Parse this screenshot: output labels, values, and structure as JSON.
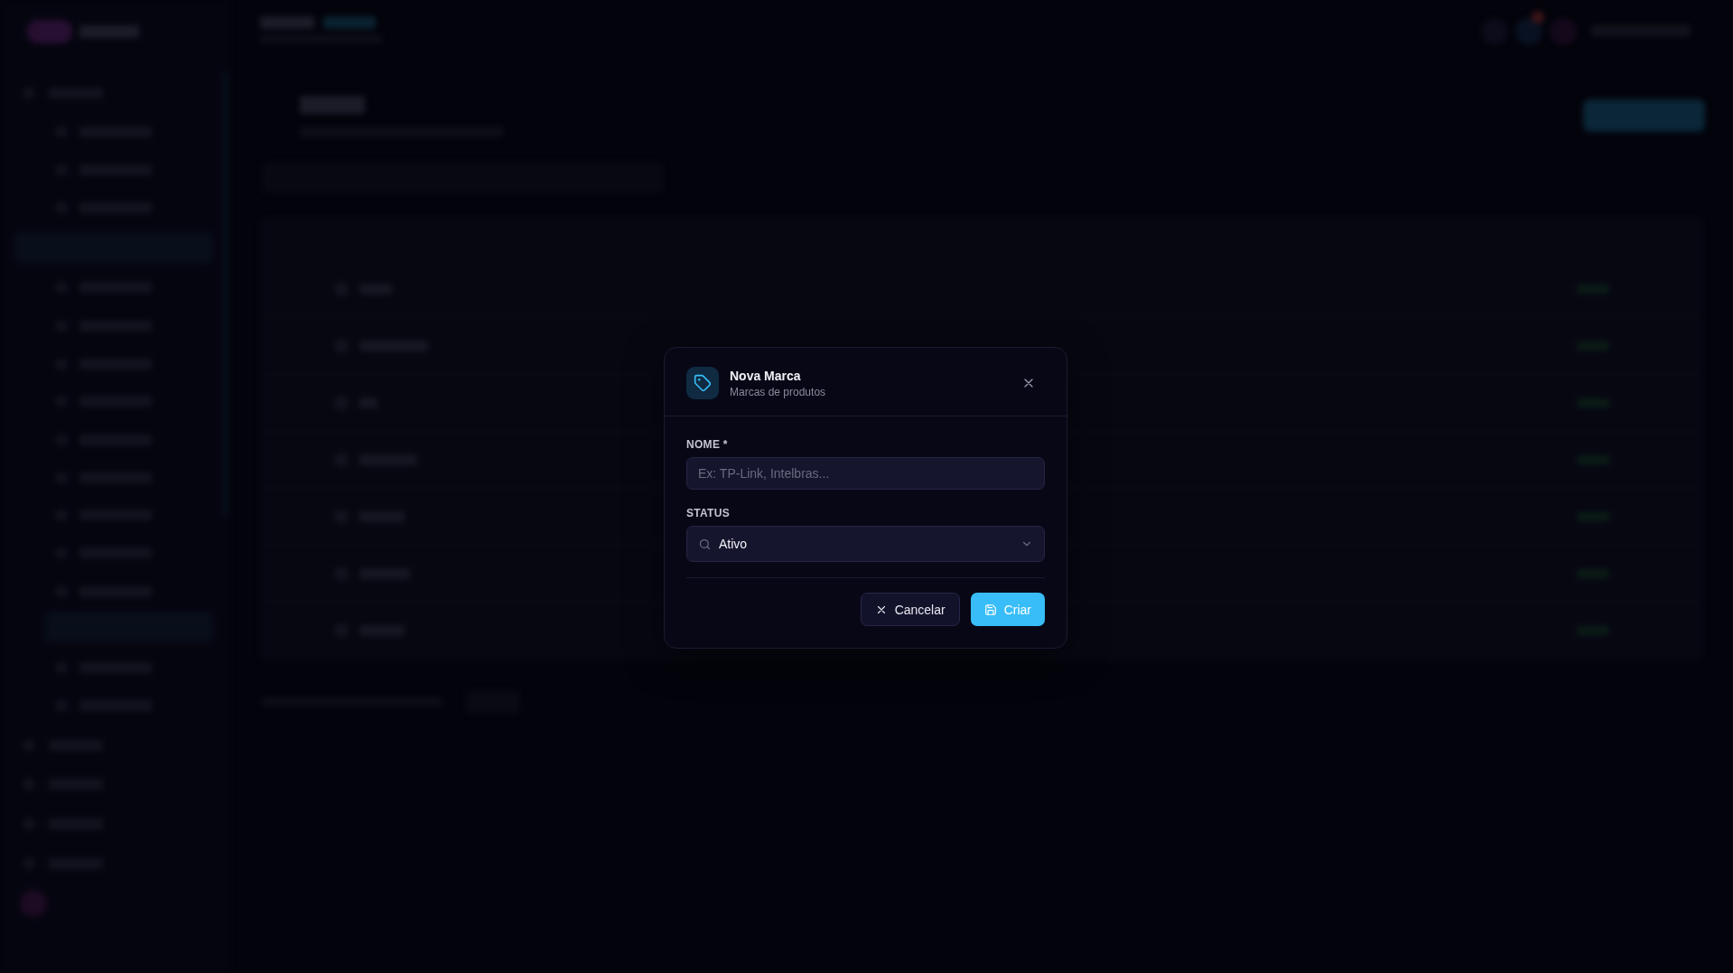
{
  "background": {
    "kind": "blurred"
  },
  "modal": {
    "title": "Nova Marca",
    "subtitle": "Marcas de produtos",
    "fields": [
      {
        "kind": "text",
        "label": "NOME *",
        "placeholder": "Ex: TP-Link, Intelbras..."
      },
      {
        "kind": "select",
        "label": "STATUS",
        "value": "Ativo"
      }
    ],
    "buttons": [
      {
        "kind": "secondary",
        "label": "Cancelar"
      },
      {
        "kind": "primary",
        "label": "Criar"
      }
    ]
  }
}
